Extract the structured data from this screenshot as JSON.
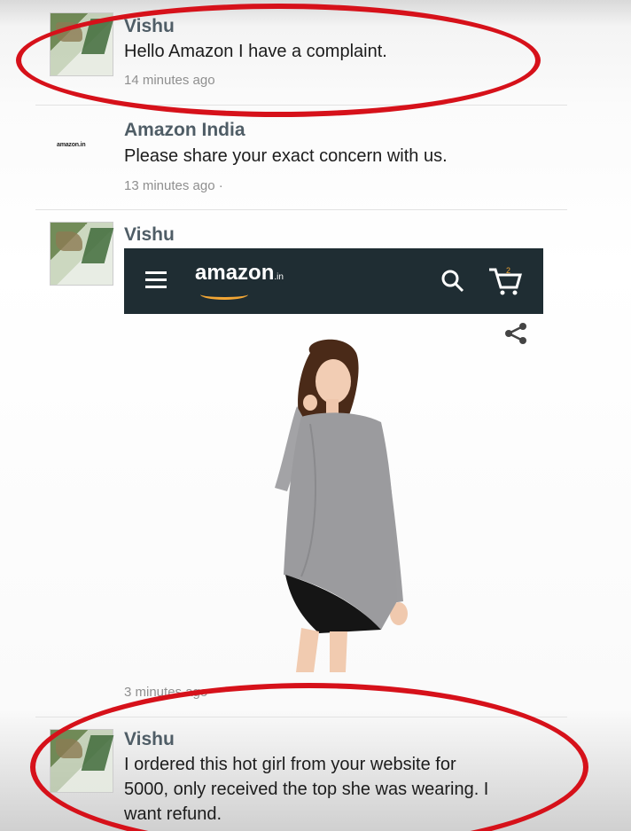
{
  "comments": [
    {
      "author": "Vishu",
      "text": "Hello Amazon I have a complaint.",
      "time": "14 minutes ago"
    },
    {
      "author": "Amazon India",
      "text": "Please share your exact concern with us.",
      "time": "13 minutes ago ·",
      "avatar_label": "amazon.in"
    },
    {
      "author": "Vishu",
      "time": "3 minutes ago"
    },
    {
      "author": "Vishu",
      "text_lines": [
        "I ordered this hot girl from your website for",
        "5000, only received the top she was wearing. I",
        "want refund."
      ]
    }
  ],
  "amazon_bar": {
    "logo": "amazon",
    "logo_suffix": ".in",
    "cart_count": "2"
  },
  "colors": {
    "highlight": "#d6111a",
    "bar_bg": "#1f2d33",
    "smile": "#f3a634"
  },
  "icons": [
    "menu-icon",
    "search-icon",
    "cart-icon",
    "share-icon"
  ]
}
